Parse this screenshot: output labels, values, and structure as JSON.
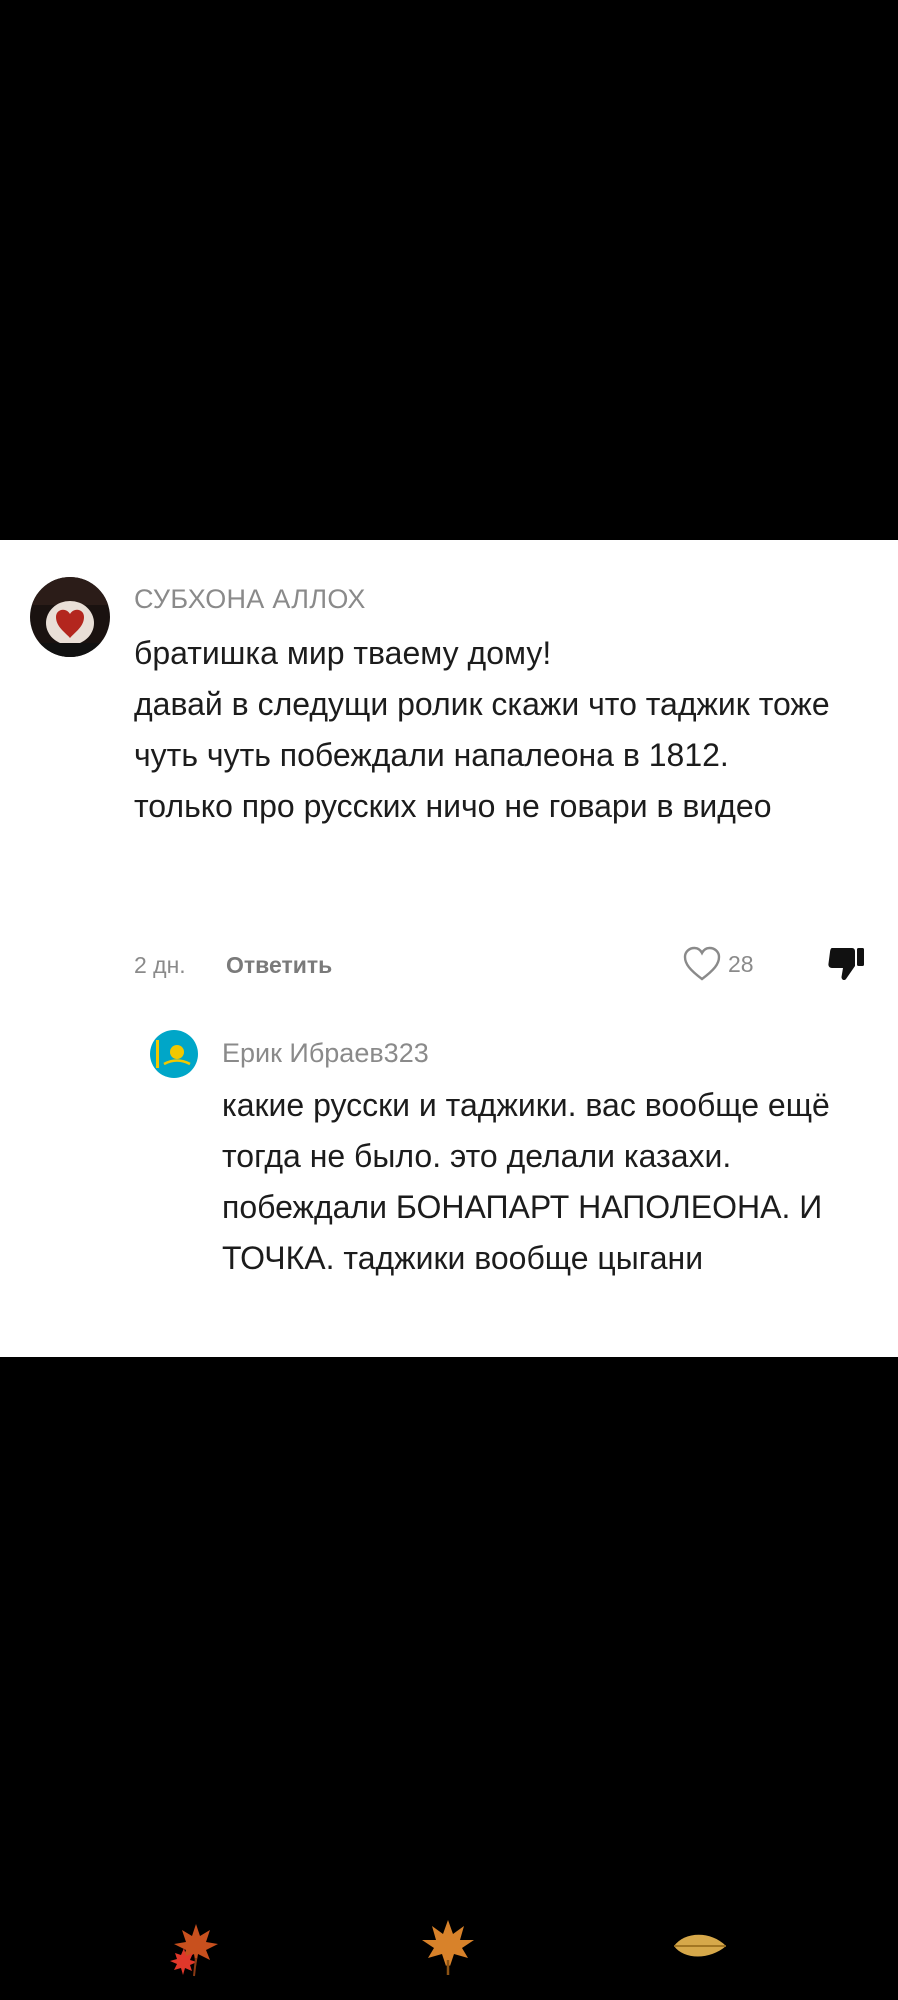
{
  "comment": {
    "username": "СУБХОНА АЛЛОХ",
    "text": "братишка мир тваему дому!\nдавай в следущи ролик скажи что таджик тоже чуть чуть побеждали напалеона в 1812.\nтолько про русских ничо не говари в видео",
    "time": "2 дн.",
    "reply_label": "Ответить",
    "likes": "28",
    "avatar_icon": "heart-seal-avatar"
  },
  "reply": {
    "username": "Ерик Ибраев323",
    "text": "какие русски и таджики. вас вообще ещё тогда не было. это делали казахи. побеждали БОНАПАРТ НАПОЛЕОНА. И ТОЧКА. таджики вообще цыгани",
    "avatar_icon": "kazakhstan-flag-avatar"
  },
  "decorations": [
    "maple-leaves-icon",
    "maple-leaf-icon",
    "autumn-leaf-icon"
  ],
  "colors": {
    "background": "#000000",
    "card": "#ffffff",
    "text": "#1c1c1c",
    "muted": "#8a8a8a",
    "kazakh_flag": "#00a6c8",
    "kazakh_sun": "#f2c800"
  }
}
